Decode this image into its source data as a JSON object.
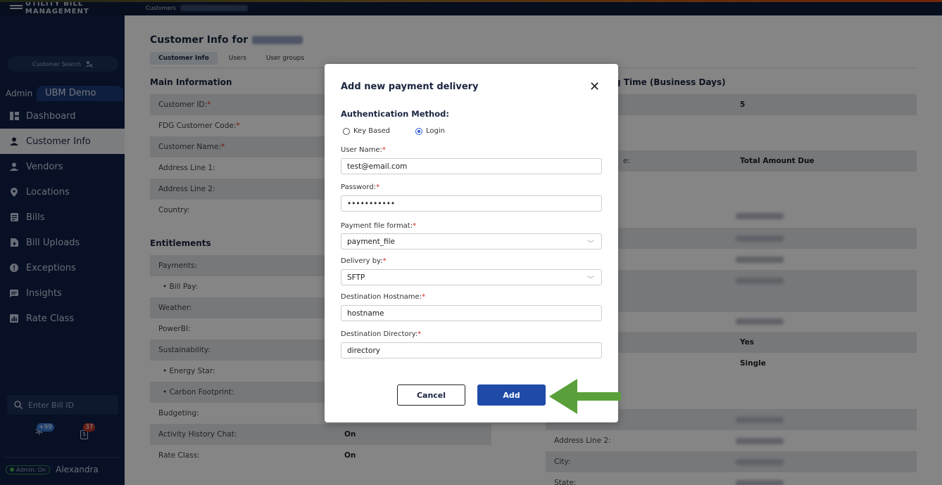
{
  "app": {
    "brand": "UTILITY BILL MANAGEMENT",
    "breadcrumb_root": "Customers"
  },
  "sidebar": {
    "customer_search": "Customer Search",
    "admin_label": "Admin",
    "org_tab": "UBM Demo",
    "items": [
      {
        "label": "Dashboard",
        "icon": "dashboard-icon"
      },
      {
        "label": "Customer Info",
        "icon": "person-icon"
      },
      {
        "label": "Vendors",
        "icon": "vendor-icon"
      },
      {
        "label": "Locations",
        "icon": "location-pin-icon"
      },
      {
        "label": "Bills",
        "icon": "bill-icon"
      },
      {
        "label": "Bill Uploads",
        "icon": "upload-icon"
      },
      {
        "label": "Exceptions",
        "icon": "exclamation-icon"
      },
      {
        "label": "Insights",
        "icon": "insights-icon"
      },
      {
        "label": "Rate Class",
        "icon": "rate-class-icon"
      }
    ],
    "bill_id_placeholder": "Enter Bill ID",
    "badge_asterisk": "+99",
    "badge_bills": "37",
    "admin_status": "Admin: On",
    "user_name": "Alexandra"
  },
  "main": {
    "title_prefix": "Customer Info for",
    "tabs": [
      "Customer Info",
      "Users",
      "User groups"
    ],
    "main_info_title": "Main Information",
    "main_info_rows": [
      {
        "label": "Customer ID:",
        "required": true
      },
      {
        "label": "FDG Customer Code:",
        "required": true
      },
      {
        "label": "Customer Name:",
        "required": true
      },
      {
        "label": "Address Line 1:",
        "required": false
      },
      {
        "label": "Address Line 2:",
        "required": false
      },
      {
        "label": "Country:",
        "required": false
      }
    ],
    "entitlements_title": "Entitlements",
    "entitlement_rows": [
      {
        "label": "Payments:",
        "value": ""
      },
      {
        "label": "•  Bill Pay:",
        "value": ""
      },
      {
        "label": "Weather:",
        "value": ""
      },
      {
        "label": "PowerBI:",
        "value": ""
      },
      {
        "label": "Sustainability:",
        "value": ""
      },
      {
        "label": "•  Energy Star:",
        "value": ""
      },
      {
        "label": "•  Carbon Footprint:",
        "value": ""
      },
      {
        "label": "Budgeting:",
        "value": ""
      },
      {
        "label": "Activity History Chat:",
        "value": "On"
      },
      {
        "label": "Rate Class:",
        "value": "On"
      }
    ],
    "right_title": "g Time (Business Days)",
    "right_rows": [
      {
        "label": "",
        "value": "5"
      },
      {
        "label": "",
        "value": ""
      },
      {
        "label": "e:",
        "value": "Total Amount Due"
      },
      {
        "label": "",
        "value": "Yes"
      },
      {
        "label": "",
        "value": "Single"
      },
      {
        "label": "Address Line 2:",
        "value": ""
      },
      {
        "label": "City:",
        "value": ""
      },
      {
        "label": "State:",
        "value": ""
      }
    ]
  },
  "modal": {
    "title": "Add new payment delivery",
    "auth_title": "Authentication Method:",
    "auth_options": [
      "Key Based",
      "Login"
    ],
    "auth_selected": "Login",
    "username_label": "User Name:",
    "username_value": "test@email.com",
    "password_label": "Password:",
    "password_value": "•••••••••••",
    "file_format_label": "Payment file format:",
    "file_format_value": "payment_file",
    "delivery_label": "Delivery by:",
    "delivery_value": "SFTP",
    "hostname_label": "Destination Hostname:",
    "hostname_value": "hostname",
    "directory_label": "Destination Directory:",
    "directory_value": "directory",
    "cancel_label": "Cancel",
    "add_label": "Add",
    "required_mark": "*"
  },
  "colors": {
    "sidebar_bg": "#0f1f45",
    "primary_button": "#1f4aa8",
    "required": "#d0281e",
    "arrow": "#5aa03a"
  }
}
